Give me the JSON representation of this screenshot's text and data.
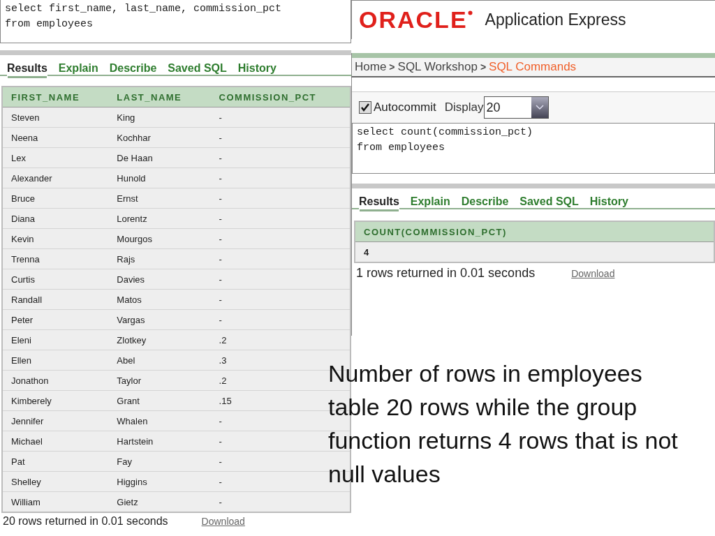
{
  "left_panel": {
    "sql_editor": {
      "lines": [
        "select first_name, last_name, commission_pct",
        "from employees"
      ]
    },
    "tabs": [
      {
        "label": "Results",
        "selected": true
      },
      {
        "label": "Explain",
        "selected": false
      },
      {
        "label": "Describe",
        "selected": false
      },
      {
        "label": "Saved SQL",
        "selected": false
      },
      {
        "label": "History",
        "selected": false
      }
    ],
    "table": {
      "columns": [
        "FIRST_NAME",
        "LAST_NAME",
        "COMMISSION_PCT"
      ],
      "rows": [
        [
          "Steven",
          "King",
          "-"
        ],
        [
          "Neena",
          "Kochhar",
          "-"
        ],
        [
          "Lex",
          "De Haan",
          "-"
        ],
        [
          "Alexander",
          "Hunold",
          "-"
        ],
        [
          "Bruce",
          "Ernst",
          "-"
        ],
        [
          "Diana",
          "Lorentz",
          "-"
        ],
        [
          "Kevin",
          "Mourgos",
          "-"
        ],
        [
          "Trenna",
          "Rajs",
          "-"
        ],
        [
          "Curtis",
          "Davies",
          "-"
        ],
        [
          "Randall",
          "Matos",
          "-"
        ],
        [
          "Peter",
          "Vargas",
          "-"
        ],
        [
          "Eleni",
          "Zlotkey",
          ".2"
        ],
        [
          "Ellen",
          "Abel",
          ".3"
        ],
        [
          "Jonathon",
          "Taylor",
          ".2"
        ],
        [
          "Kimberely",
          "Grant",
          ".15"
        ],
        [
          "Jennifer",
          "Whalen",
          "-"
        ],
        [
          "Michael",
          "Hartstein",
          "-"
        ],
        [
          "Pat",
          "Fay",
          "-"
        ],
        [
          "Shelley",
          "Higgins",
          "-"
        ],
        [
          "William",
          "Gietz",
          "-"
        ]
      ]
    },
    "status": "20 rows returned in 0.01 seconds",
    "download_link": "Download"
  },
  "right_panel": {
    "logo": "ORACLE",
    "product": "Application Express",
    "breadcrumb": [
      {
        "label": "Home",
        "current": false
      },
      {
        "label": "SQL Workshop",
        "current": false
      },
      {
        "label": "SQL Commands",
        "current": true
      }
    ],
    "breadcrumb_separator": ">",
    "autocommit": {
      "label": "Autocommit",
      "checked": true
    },
    "display": {
      "label": "Display",
      "value": "20"
    },
    "sql_editor": {
      "lines": [
        "select count(commission_pct)",
        "from employees"
      ]
    },
    "tabs": [
      {
        "label": "Results",
        "selected": true
      },
      {
        "label": "Explain",
        "selected": false
      },
      {
        "label": "Describe",
        "selected": false
      },
      {
        "label": "Saved SQL",
        "selected": false
      },
      {
        "label": "History",
        "selected": false
      }
    ],
    "table": {
      "columns": [
        "COUNT(COMMISSION_PCT)"
      ],
      "rows": [
        [
          "4"
        ]
      ]
    },
    "status": "1 rows returned in 0.01 seconds",
    "download_link": "Download"
  },
  "caption": "Number of rows in employees table 20 rows while the group function returns 4 rows that is not null values"
}
